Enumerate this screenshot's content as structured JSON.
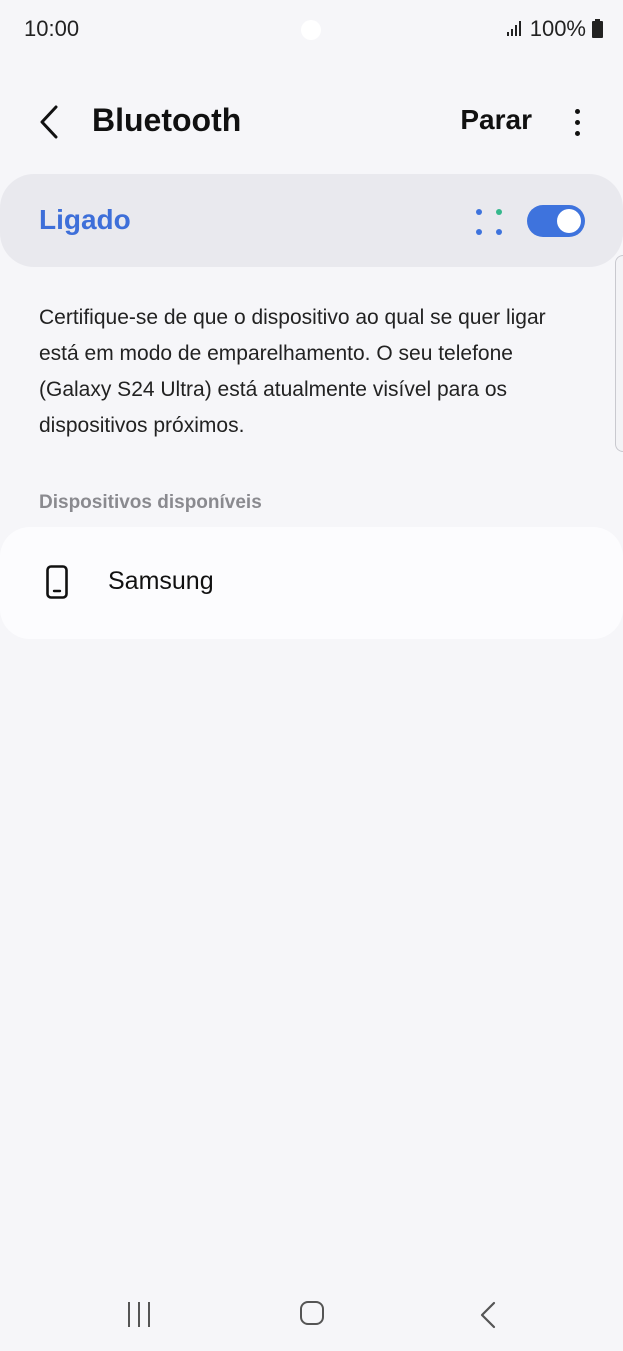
{
  "status_bar": {
    "time": "10:00",
    "battery": "100%"
  },
  "app_bar": {
    "title": "Bluetooth",
    "stop_label": "Parar"
  },
  "toggle": {
    "label": "Ligado",
    "state": "on",
    "accent_color": "#3e73dd"
  },
  "info_text": "Certifique-se de que o dispositivo ao qual se quer ligar está em modo de emparelhamento. O seu telefone (Galaxy S24 Ultra) está atualmente visível para os dispositivos próximos.",
  "available_devices": {
    "header": "Dispositivos disponíveis",
    "items": [
      {
        "name": "Samsung",
        "icon": "phone-icon"
      }
    ]
  },
  "icons": {
    "back": "back-arrow-icon",
    "more": "more-options-icon",
    "scan": "scanning-icon",
    "signal": "signal-icon",
    "battery": "battery-icon",
    "nav_recent": "recent-apps-icon",
    "nav_home": "home-icon",
    "nav_back": "nav-back-icon"
  }
}
